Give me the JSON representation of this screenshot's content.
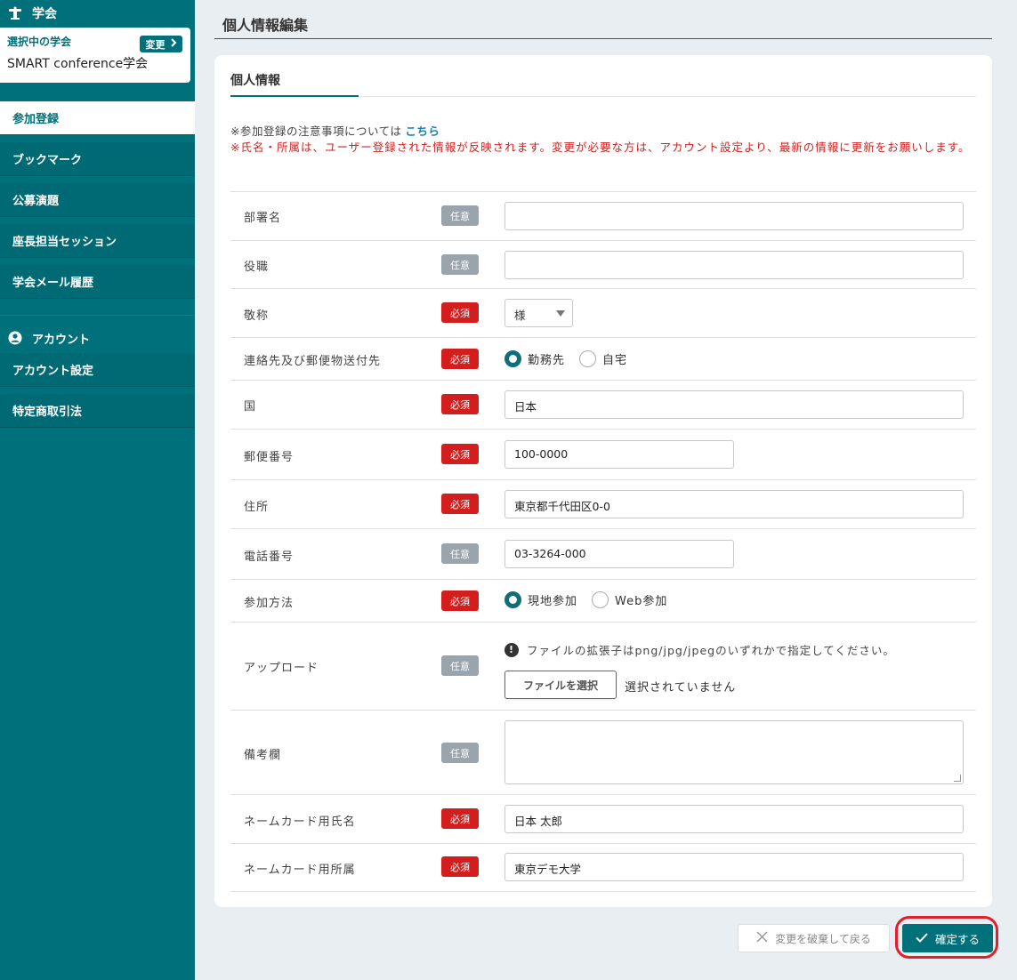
{
  "sidebar": {
    "society_header": "学会",
    "selected_label": "選択中の学会",
    "change_label": "変更",
    "society_name": "SMART conference学会",
    "items": [
      {
        "label": "参加登録"
      },
      {
        "label": "ブックマーク"
      },
      {
        "label": "公募演題"
      },
      {
        "label": "座長担当セッション"
      },
      {
        "label": "学会メール履歴"
      }
    ],
    "account_header": "アカウント",
    "account_items": [
      {
        "label": "アカウント設定"
      },
      {
        "label": "特定商取引法"
      }
    ]
  },
  "page": {
    "title": "個人情報編集",
    "card_title": "個人情報",
    "note_prefix": "※参加登録の注意事項については",
    "note_link": "こちら",
    "note_warning": "※氏名・所属は、ユーザー登録された情報が反映されます。変更が必要な方は、アカウント設定より、最新の情報に更新をお願いします。"
  },
  "badges": {
    "optional": "任意",
    "required": "必須"
  },
  "form": {
    "department": {
      "label": "部署名",
      "value": ""
    },
    "position": {
      "label": "役職",
      "value": ""
    },
    "honorific": {
      "label": "敬称",
      "value": "様"
    },
    "contact": {
      "label": "連絡先及び郵便物送付先",
      "options": [
        "勤務先",
        "自宅"
      ],
      "selected": "勤務先"
    },
    "country": {
      "label": "国",
      "value": "日本"
    },
    "postal": {
      "label": "郵便番号",
      "value": "100-0000"
    },
    "address": {
      "label": "住所",
      "value": "東京都千代田区0-0"
    },
    "phone": {
      "label": "電話番号",
      "value": "03-3264-000"
    },
    "attendance": {
      "label": "参加方法",
      "options": [
        "現地参加",
        "Web参加"
      ],
      "selected": "現地参加"
    },
    "upload": {
      "label": "アップロード",
      "hint": "ファイルの拡張子はpng/jpg/jpegのいずれかで指定してください。",
      "button": "ファイルを選択",
      "status": "選択されていません"
    },
    "remarks": {
      "label": "備考欄",
      "value": ""
    },
    "card_name": {
      "label": "ネームカード用氏名",
      "value": "日本 太郎"
    },
    "card_affiliation": {
      "label": "ネームカード用所属",
      "value": "東京デモ大学"
    }
  },
  "actions": {
    "discard": "変更を破棄して戻る",
    "confirm": "確定する"
  },
  "colors": {
    "primary": "#00707a",
    "required": "#d41e1e",
    "optional": "#9aa4ad",
    "link": "#1b7fb3",
    "highlight": "#e3202a"
  }
}
